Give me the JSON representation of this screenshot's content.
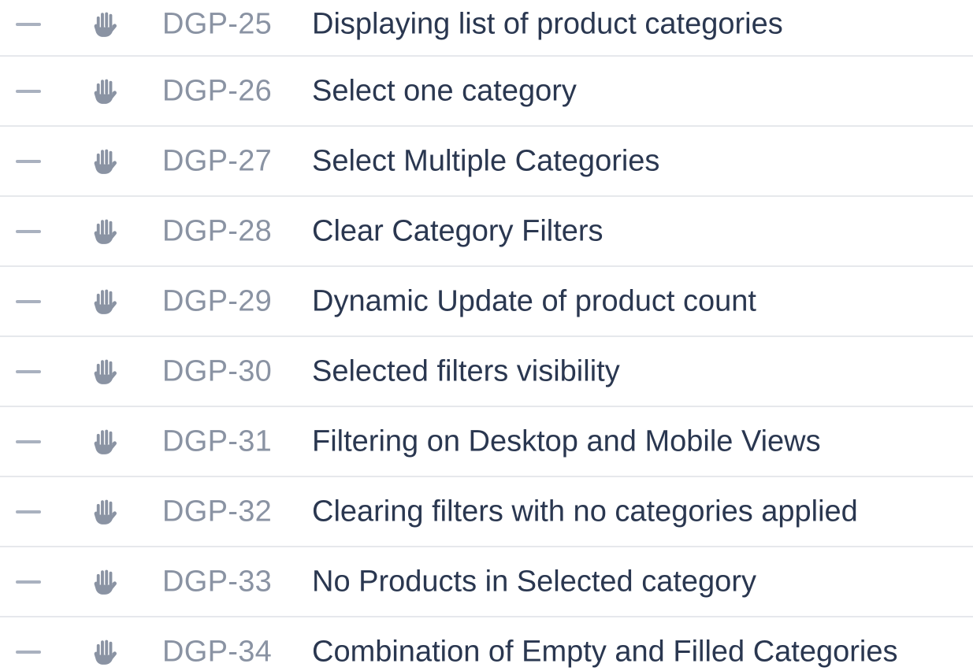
{
  "issues": [
    {
      "key": "DGP-25",
      "summary": "Displaying list of product categories",
      "priority_icon": "priority-minus-icon",
      "type_icon": "hand-icon"
    },
    {
      "key": "DGP-26",
      "summary": "Select one category",
      "priority_icon": "priority-minus-icon",
      "type_icon": "hand-icon"
    },
    {
      "key": "DGP-27",
      "summary": "Select Multiple Categories",
      "priority_icon": "priority-minus-icon",
      "type_icon": "hand-icon"
    },
    {
      "key": "DGP-28",
      "summary": "Clear Category Filters",
      "priority_icon": "priority-minus-icon",
      "type_icon": "hand-icon"
    },
    {
      "key": "DGP-29",
      "summary": "Dynamic Update of product count",
      "priority_icon": "priority-minus-icon",
      "type_icon": "hand-icon"
    },
    {
      "key": "DGP-30",
      "summary": "Selected filters visibility",
      "priority_icon": "priority-minus-icon",
      "type_icon": "hand-icon"
    },
    {
      "key": "DGP-31",
      "summary": "Filtering on Desktop and Mobile Views",
      "priority_icon": "priority-minus-icon",
      "type_icon": "hand-icon"
    },
    {
      "key": "DGP-32",
      "summary": "Clearing filters with no categories applied",
      "priority_icon": "priority-minus-icon",
      "type_icon": "hand-icon"
    },
    {
      "key": "DGP-33",
      "summary": "No Products in Selected category",
      "priority_icon": "priority-minus-icon",
      "type_icon": "hand-icon"
    },
    {
      "key": "DGP-34",
      "summary": "Combination of Empty and Filled Categories",
      "priority_icon": "priority-minus-icon",
      "type_icon": "hand-icon"
    }
  ],
  "colors": {
    "key_text": "#8a93a3",
    "summary_text": "#2a3750",
    "icon": "#8a93a3",
    "divider": "#e6e8ec"
  }
}
